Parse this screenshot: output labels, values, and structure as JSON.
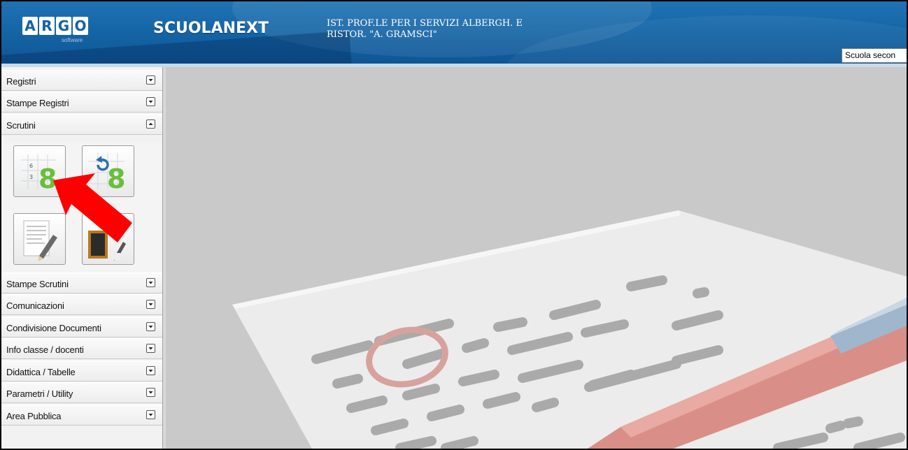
{
  "header": {
    "logo_letters": [
      "A",
      "R",
      "G",
      "O"
    ],
    "logo_subtitle": "software",
    "brand": "SCUOLANEXT",
    "school_line1": "IST. PROF.LE PER I SERVIZI ALBERGH. E",
    "school_line2": "RISTOR. \"A. GRAMSCI\"",
    "school_select_value": "Scuola secon"
  },
  "sidebar": {
    "items": [
      {
        "label": "Registri",
        "state": "collapsed"
      },
      {
        "label": "Stampe Registri",
        "state": "collapsed"
      },
      {
        "label": "Scrutini",
        "state": "expanded"
      },
      {
        "label": "Stampe Scrutini",
        "state": "collapsed"
      },
      {
        "label": "Comunicazioni",
        "state": "collapsed"
      },
      {
        "label": "Condivisione Documenti",
        "state": "collapsed"
      },
      {
        "label": "Info classe / docenti",
        "state": "collapsed"
      },
      {
        "label": "Didattica / Tabelle",
        "state": "collapsed"
      },
      {
        "label": "Parametri / Utility",
        "state": "collapsed"
      },
      {
        "label": "Area Pubblica",
        "state": "collapsed"
      }
    ],
    "scrutini_tiles": [
      {
        "icon": "grades-grid-icon",
        "digits": [
          "6",
          "3"
        ],
        "big": "8"
      },
      {
        "icon": "grades-refresh-icon",
        "big": "8"
      },
      {
        "icon": "document-edit-icon"
      },
      {
        "icon": "board-edit-icon"
      }
    ]
  },
  "colors": {
    "header_blue": "#1565a6",
    "grade_green": "#6abf3a",
    "annotation_arrow": "#ff0000",
    "main_bg": "#c9c9c9"
  },
  "annotation": {
    "icon": "red-arrow-annotation"
  }
}
